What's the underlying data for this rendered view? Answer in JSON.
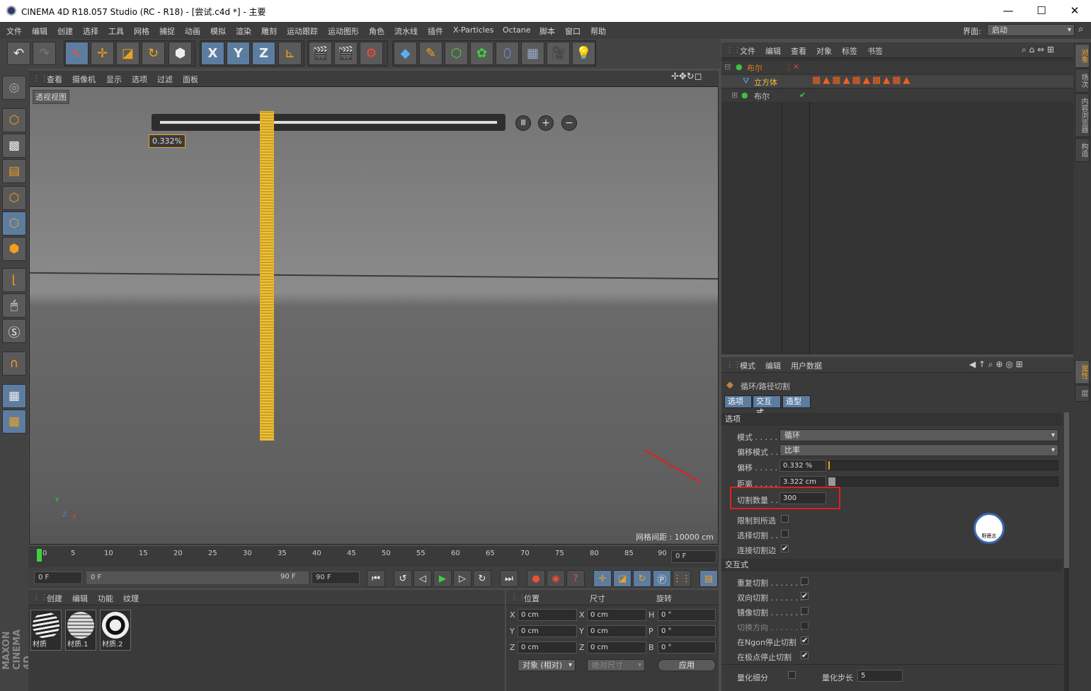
{
  "window": {
    "title": "CINEMA 4D R18.057 Studio (RC - R18) - [尝试.c4d *] - 主要",
    "minimize": "—",
    "maximize": "☐",
    "close": "✕"
  },
  "menu": {
    "items": [
      "文件",
      "编辑",
      "创建",
      "选择",
      "工具",
      "网格",
      "捕捉",
      "动画",
      "模拟",
      "渲染",
      "雕刻",
      "运动跟踪",
      "运动图形",
      "角色",
      "流水线",
      "插件",
      "X-Particles",
      "Octane",
      "脚本",
      "窗口",
      "帮助"
    ],
    "layout_label": "界面:",
    "layout_value": "启动"
  },
  "toolbar": {
    "undo": "↶",
    "redo": "↷",
    "x": "X",
    "y": "Y",
    "z": "Z"
  },
  "viewport": {
    "menu": [
      "查看",
      "摄像机",
      "显示",
      "选项",
      "过滤",
      "面板"
    ],
    "label": "透视视图",
    "offset_tooltip": "0.332%",
    "grid_spacing": "网格间距 : 10000 cm",
    "axis_y": "Y",
    "axis_z": "Z",
    "axis_x": "X"
  },
  "timeline": {
    "ticks": [
      "0",
      "5",
      "10",
      "15",
      "20",
      "25",
      "30",
      "35",
      "40",
      "45",
      "50",
      "55",
      "60",
      "65",
      "70",
      "75",
      "80",
      "85",
      "90"
    ],
    "current_frame": "0 F"
  },
  "transport": {
    "start": "0 F",
    "range_start": "0 F",
    "range_end": "90 F",
    "end": "90 F"
  },
  "materials": {
    "menu": [
      "创建",
      "编辑",
      "功能",
      "纹理"
    ],
    "items": [
      "材质",
      "材质.1",
      "材质.2"
    ]
  },
  "coords": {
    "headers": [
      "位置",
      "尺寸",
      "旋转"
    ],
    "rows": [
      {
        "a": "X",
        "pos": "0 cm",
        "b": "X",
        "size": "0 cm",
        "c": "H",
        "rot": "0 °"
      },
      {
        "a": "Y",
        "pos": "0 cm",
        "b": "Y",
        "size": "0 cm",
        "c": "P",
        "rot": "0 °"
      },
      {
        "a": "Z",
        "pos": "0 cm",
        "b": "Z",
        "size": "0 cm",
        "c": "B",
        "rot": "0 °"
      }
    ],
    "mode": "对象 (相对)",
    "size_mode": "绝对尺寸",
    "apply": "应用"
  },
  "objects": {
    "menu": [
      "文件",
      "编辑",
      "查看",
      "对象",
      "标签",
      "书签"
    ],
    "tree": [
      {
        "name": "布尔",
        "color": "#e07a20"
      },
      {
        "name": "立方体",
        "color": "#f0c040"
      },
      {
        "name": "布尔",
        "color": "#c8c8c8"
      }
    ]
  },
  "attributes": {
    "menu": [
      "模式",
      "编辑",
      "用户数据"
    ],
    "tool_name": "循环/路径切割",
    "tabs": [
      "选项",
      "交互式",
      "造型"
    ],
    "section_options": "选项",
    "mode_label": "模式 . . . . .",
    "mode_value": "循环",
    "offset_mode_label": "偏移模式 . .",
    "offset_mode_value": "比率",
    "offset_label": "偏移 . . . . .",
    "offset_value": "0.332 %",
    "distance_label": "距离 . . . . .",
    "distance_value": "3.322 cm",
    "cuts_label": "切割数量 . .",
    "cuts_value": "300",
    "limit_label": "限制到所选",
    "select_cuts_label": "选择切割 . .",
    "connect_label": "连接切割边",
    "section_interactive": "交互式",
    "repeat_label": "重复切割 . . . . . . .",
    "bidir_label": "双向切割 . . . . . . .",
    "mirror_label": "镜像切割 . . . . . . .",
    "switch_label": "切换方向 . . . . . . .",
    "ngon_label": "在Ngon停止切割",
    "pole_label": "在极点停止切割",
    "quant_label": "量化细分",
    "quant_step_label": "量化步长",
    "quant_step_value": "5",
    "check": "✔"
  },
  "right_tabs": [
    "对象",
    "场次",
    "内容浏览器",
    "构造",
    "属性",
    "层"
  ],
  "watermark": "野鹿志",
  "brand": "MAXON CINEMA 4D"
}
